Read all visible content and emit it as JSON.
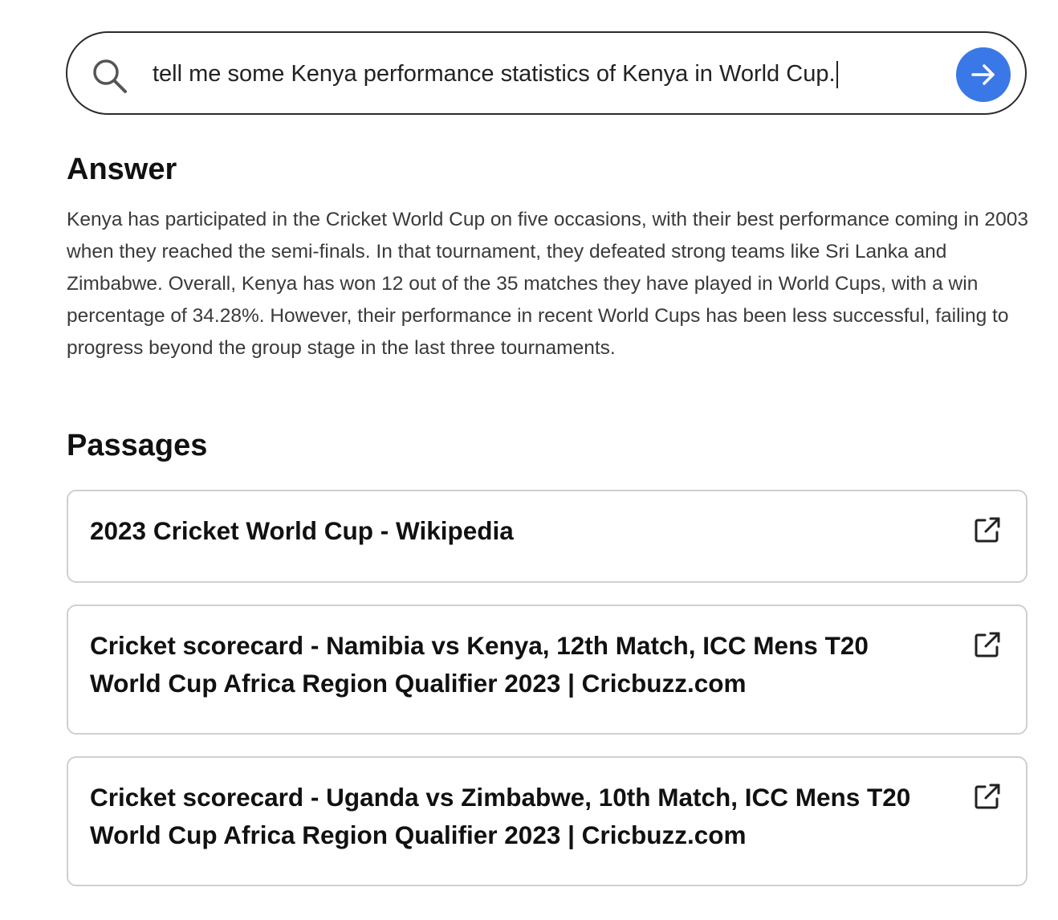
{
  "search": {
    "query": "tell me some Kenya performance statistics of Kenya in World Cup.",
    "search_icon": "search-icon",
    "submit_icon": "arrow-right-icon"
  },
  "answer": {
    "heading": "Answer",
    "text": "Kenya has participated in the Cricket World Cup on five occasions, with their best performance coming in 2003 when they reached the semi-finals. In that tournament, they defeated strong teams like Sri Lanka and Zimbabwe. Overall, Kenya has won 12 out of the 35 matches they have played in World Cups, with a win percentage of 34.28%. However, their performance in recent World Cups has been less successful, failing to progress beyond the group stage in the last three tournaments."
  },
  "passages": {
    "heading": "Passages",
    "items": [
      {
        "title": "2023 Cricket World Cup - Wikipedia",
        "icon": "external-link-icon"
      },
      {
        "title": "Cricket scorecard - Namibia vs Kenya, 12th Match, ICC Mens T20 World Cup Africa Region Qualifier 2023 | Cricbuzz.com",
        "icon": "external-link-icon"
      },
      {
        "title": "Cricket scorecard - Uganda vs Zimbabwe, 10th Match, ICC Mens T20 World Cup Africa Region Qualifier 2023 | Cricbuzz.com",
        "icon": "external-link-icon"
      }
    ]
  },
  "colors": {
    "accent": "#3b78e7",
    "border": "#2b2b2b",
    "card_border": "#cfcfcf",
    "body_text": "#3a3a3a"
  }
}
